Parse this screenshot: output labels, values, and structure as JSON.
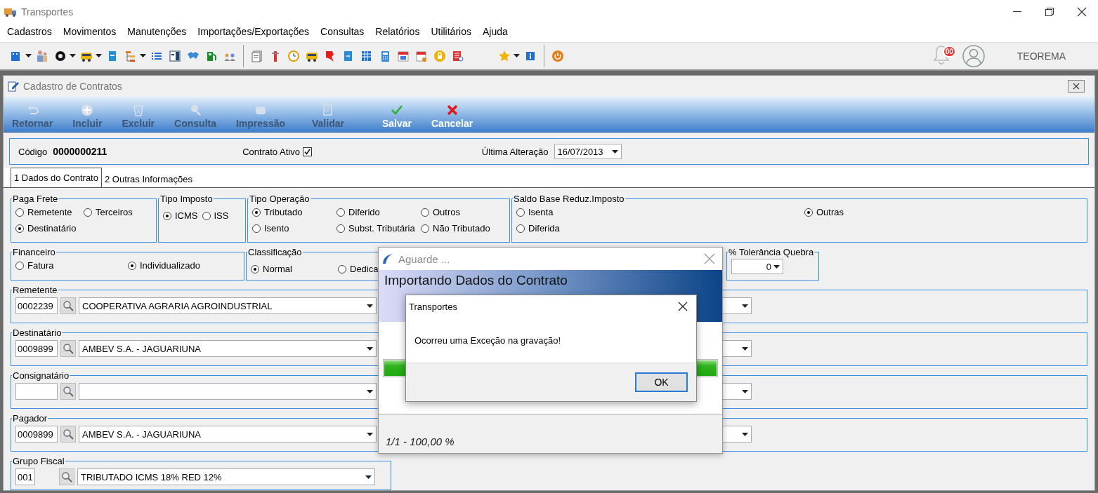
{
  "window": {
    "title": "Transportes"
  },
  "menu": [
    "Cadastros",
    "Movimentos",
    "Manutenções",
    "Importações/Exportações",
    "Consultas",
    "Relatórios",
    "Utilitários",
    "Ajuda"
  ],
  "user": {
    "notification_count": "00",
    "name": "TEOREMA"
  },
  "child_window": {
    "title": "Cadastro de Contratos"
  },
  "actions": [
    {
      "kind": "back",
      "label": "Retornar",
      "disabled": true
    },
    {
      "kind": "add",
      "label": "Incluir",
      "disabled": true
    },
    {
      "kind": "delete",
      "label": "Excluir",
      "disabled": true
    },
    {
      "kind": "search",
      "label": "Consulta",
      "disabled": true
    },
    {
      "kind": "print",
      "label": "Impressão",
      "disabled": true
    },
    {
      "kind": "validate",
      "label": "Validar",
      "disabled": true
    },
    {
      "kind": "save",
      "label": "Salvar",
      "disabled": false
    },
    {
      "kind": "cancel",
      "label": "Cancelar",
      "disabled": false
    }
  ],
  "header": {
    "code_label": "Código",
    "code": "0000000211",
    "active_label": "Contrato Ativo",
    "active_checked": true,
    "last_change_label": "Última Alteração",
    "last_change": "16/07/2013"
  },
  "tabs": [
    {
      "label": "1 Dados do Contrato",
      "selected": true
    },
    {
      "label": "2 Outras Informações",
      "selected": false
    }
  ],
  "group_rows": [
    [
      {
        "kind": "radios",
        "title": "Paga Frete",
        "rows": [
          [
            {
              "label": "Remetente",
              "selected": false
            },
            {
              "label": "Terceiros",
              "selected": false
            }
          ],
          [
            {
              "label": "Destinatário",
              "selected": true
            }
          ]
        ]
      },
      {
        "kind": "radios",
        "title": "Tipo Imposto",
        "rows": [
          [
            {
              "label": "ICMS",
              "selected": true
            },
            {
              "label": "ISS",
              "selected": false
            }
          ]
        ]
      },
      {
        "kind": "radios",
        "title": "Tipo Operação",
        "rows": [
          [
            {
              "label": "Tributado",
              "selected": true
            },
            {
              "label": "Diferido",
              "selected": false
            },
            {
              "label": "Outros",
              "selected": false
            }
          ],
          [
            {
              "label": "Isento",
              "selected": false
            },
            {
              "label": "Subst. Tributária",
              "selected": false
            },
            {
              "label": "Não Tributado",
              "selected": false
            }
          ]
        ]
      },
      {
        "kind": "radios",
        "title": "Saldo Base Reduz.Imposto",
        "rows": [
          [
            {
              "label": "Isenta",
              "selected": false
            },
            {
              "label": "Outras",
              "selected": true
            }
          ],
          [
            {
              "label": "Diferida",
              "selected": false
            }
          ]
        ]
      }
    ],
    [
      {
        "kind": "radios",
        "title": "Financeiro",
        "rows": [
          [
            {
              "label": "Fatura",
              "selected": false
            },
            {
              "label": "Individualizado",
              "selected": true
            }
          ]
        ]
      },
      {
        "kind": "radios",
        "title": "Classificação",
        "rows": [
          [
            {
              "label": "Normal",
              "selected": true
            },
            {
              "label": "Dedica",
              "selected": false
            }
          ]
        ]
      },
      {
        "kind": "combo",
        "title": "% Tolerância Quebra",
        "value": "0"
      }
    ]
  ],
  "parties": [
    {
      "kind": "party",
      "label": "Remetente",
      "code": "0002239",
      "name": "COOPERATIVA AGRARIA AGROINDUSTRIAL"
    },
    {
      "kind": "party",
      "label": "Destinatário",
      "code": "0009899",
      "name": "AMBEV S.A. - JAGUARIUNA"
    },
    {
      "kind": "party",
      "label": "Consignatário"
    },
    {
      "kind": "party",
      "label": "Pagador",
      "code": "0009899",
      "name": "AMBEV S.A. - JAGUARIUNA"
    },
    {
      "kind": "fiscal",
      "label": "Grupo Fiscal",
      "code": "001",
      "name": "TRIBUTADO ICMS 18% RED 12%"
    }
  ],
  "progress_dialog": {
    "title": "Aguarde ...",
    "heading": "Importando Dados do Contrato",
    "level": 1.0,
    "status": "1/1 - 100,00 %"
  },
  "message_box": {
    "title": "Transportes",
    "message": "Ocorreu uma Exceção na gravação!",
    "button": "OK"
  }
}
